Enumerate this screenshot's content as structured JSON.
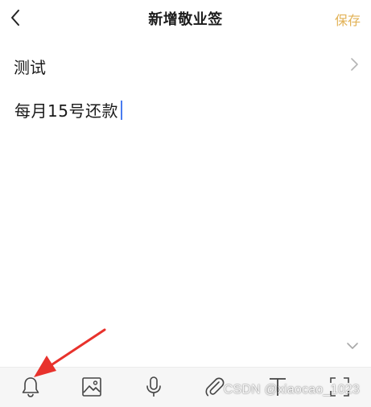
{
  "header": {
    "title": "新增敬业签",
    "save_label": "保存"
  },
  "category": {
    "label": "测试"
  },
  "note": {
    "content": "每月15号还款"
  },
  "toolbar": {
    "items": [
      {
        "icon": "bell-icon"
      },
      {
        "icon": "image-icon"
      },
      {
        "icon": "microphone-icon"
      },
      {
        "icon": "paperclip-icon"
      },
      {
        "icon": "text-format-icon"
      },
      {
        "icon": "scan-icon"
      }
    ]
  },
  "watermark": "CSDN @xiaocao_1023",
  "colors": {
    "accent": "#e2b256",
    "annotation": "#e8322c",
    "caret": "#4a7cf0"
  }
}
